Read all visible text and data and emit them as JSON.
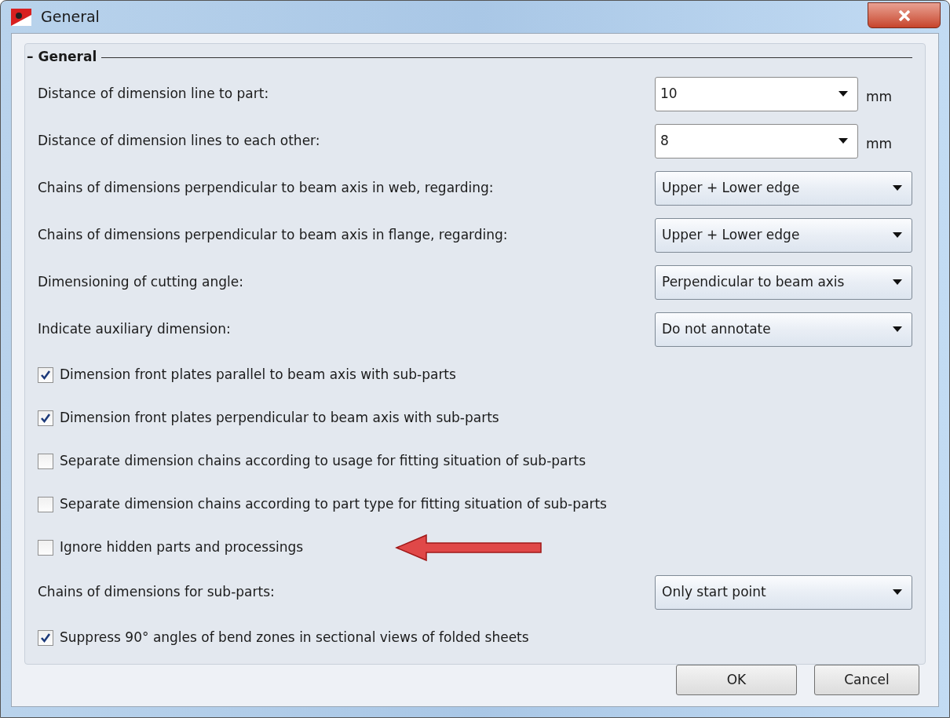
{
  "window": {
    "title": "General"
  },
  "group": {
    "toggle": "–",
    "title": "General"
  },
  "rows": [
    {
      "kind": "combo",
      "label": "Distance of dimension line to part:",
      "value": "10",
      "unit": "mm"
    },
    {
      "kind": "combo",
      "label": "Distance of dimension lines to each other:",
      "value": "8",
      "unit": "mm"
    },
    {
      "kind": "select",
      "label": "Chains of dimensions perpendicular to beam axis in web, regarding:",
      "value": "Upper + Lower edge"
    },
    {
      "kind": "select",
      "label": "Chains of dimensions perpendicular to beam axis in flange, regarding:",
      "value": "Upper + Lower edge"
    },
    {
      "kind": "select",
      "label": "Dimensioning of cutting angle:",
      "value": "Perpendicular to beam axis"
    },
    {
      "kind": "select",
      "label": "Indicate auxiliary dimension:",
      "value": "Do not annotate"
    },
    {
      "kind": "checkbox",
      "label": "Dimension front plates parallel to beam axis with sub-parts",
      "checked": true,
      "annotated": false
    },
    {
      "kind": "checkbox",
      "label": "Dimension front plates perpendicular to beam axis with sub-parts",
      "checked": true,
      "annotated": false
    },
    {
      "kind": "checkbox",
      "label": "Separate dimension chains according to usage for fitting situation of sub-parts",
      "checked": false,
      "annotated": false
    },
    {
      "kind": "checkbox",
      "label": "Separate dimension chains according to part type for fitting situation of sub-parts",
      "checked": false,
      "annotated": false
    },
    {
      "kind": "checkbox",
      "label": "Ignore hidden parts and processings",
      "checked": false,
      "annotated": true
    },
    {
      "kind": "select",
      "label": "Chains of dimensions for sub-parts:",
      "value": "Only start point"
    },
    {
      "kind": "checkbox",
      "label": "Suppress 90° angles of bend zones in sectional views of folded sheets",
      "checked": true,
      "annotated": false
    }
  ],
  "buttons": [
    "OK",
    "Cancel"
  ]
}
